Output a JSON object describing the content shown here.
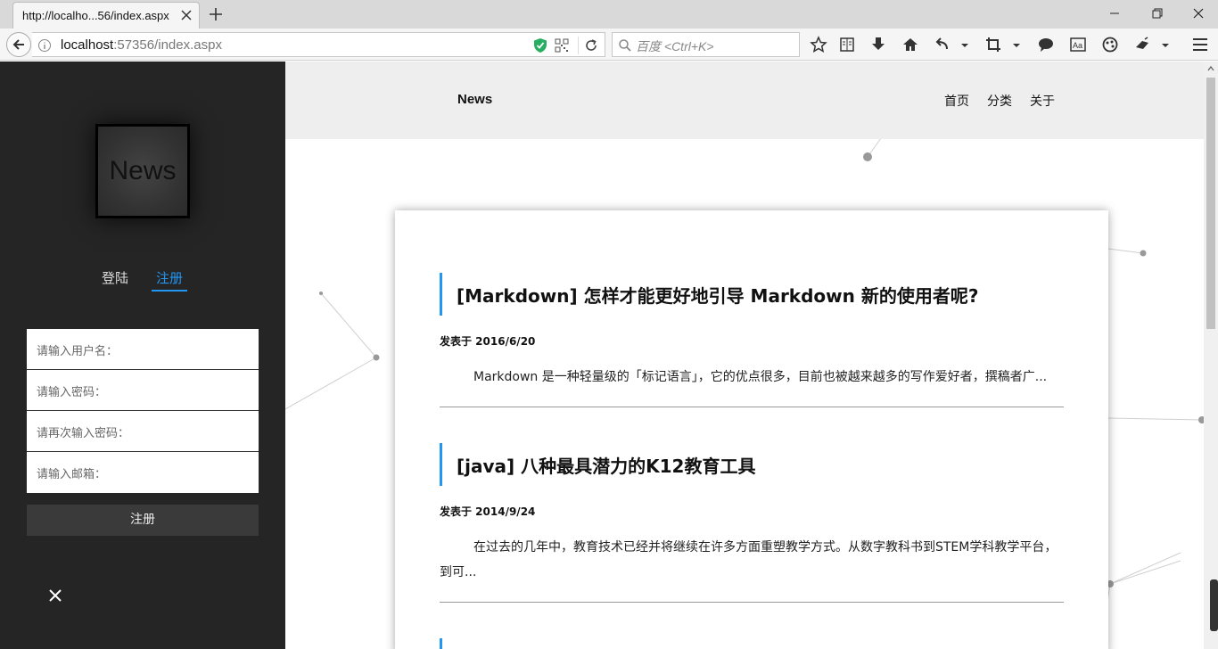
{
  "browser": {
    "tab_title": "http://localho...56/index.aspx",
    "url_host": "localhost",
    "url_rest": ":57356/index.aspx",
    "search_placeholder": "百度 <Ctrl+K>"
  },
  "sidebar": {
    "logo_text": "News",
    "tabs": {
      "login": "登陆",
      "register": "注册"
    },
    "fields": [
      "请输入用户名：",
      "请输入密码：",
      "请再次输入密码：",
      "请输入邮箱："
    ],
    "submit_label": "注册"
  },
  "header": {
    "brand": "News",
    "nav": [
      "首页",
      "分类",
      "关于"
    ]
  },
  "posts": [
    {
      "title": "[Markdown] 怎样才能更好地引导 Markdown 新的使用者呢?",
      "date": "发表于 2016/6/20",
      "summary": "Markdown 是一种轻量级的「标记语言」，它的优点很多，目前也被越来越多的写作爱好者，撰稿者广..."
    },
    {
      "title": "[java] 八种最具潜力的K12教育工具",
      "date": "发表于 2014/9/24",
      "summary": "在过去的几年中，教育技术已经并将继续在许多方面重塑教学方式。从数字教科书到STEM学科教学平台，到可..."
    }
  ],
  "colors": {
    "accent": "#2196f3",
    "sidebar_bg": "#252525",
    "header_bg": "#eeeeee"
  }
}
